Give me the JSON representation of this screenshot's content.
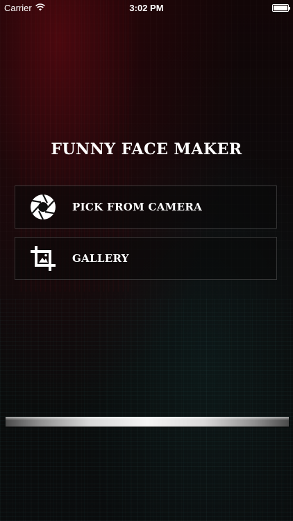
{
  "status_bar": {
    "carrier": "Carrier",
    "time": "3:02 PM",
    "battery_level": 1.0
  },
  "title": "FUNNY FACE MAKER",
  "buttons": [
    {
      "label": "PICK FROM CAMERA",
      "icon": "camera-aperture-icon"
    },
    {
      "label": "GALLERY",
      "icon": "crop-image-icon"
    }
  ]
}
